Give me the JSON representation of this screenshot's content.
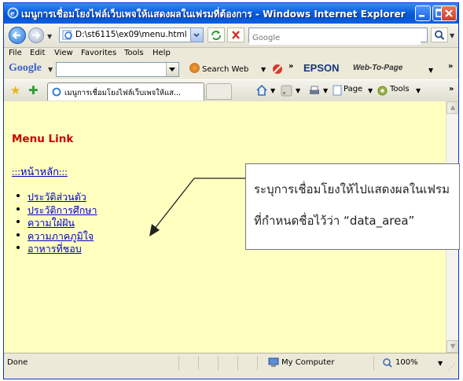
{
  "window": {
    "title": "เมนูการเชื่อมโยงไฟล์เว็บเพจให้แสดงผลในเฟรมที่ต้องการ - Windows Internet Explorer"
  },
  "address_bar": {
    "url": "D:\\st6115\\ex09\\menu.html",
    "search_placeholder": "Google"
  },
  "menu_bar": {
    "items": [
      "File",
      "Edit",
      "View",
      "Favorites",
      "Tools",
      "Help"
    ]
  },
  "google_toolbar": {
    "logo": "Google",
    "search_web_label": "Search Web",
    "epson_label": "EPSON",
    "web_to_page_label": "Web-To-Page"
  },
  "tab_bar": {
    "active_tab_title": "เมนูการเชื่อมโยงไฟล์เว็บเพจให้แส...",
    "page_label": "Page",
    "tools_label": "Tools"
  },
  "content": {
    "heading": "Menu Link",
    "home_link": ":::หน้าหลัก:::",
    "links": [
      "ประวัติส่วนตัว",
      "ประวัติการศึกษา",
      "ความใฝ่ฝัน",
      "ความภาคภูมิใจ",
      "อาหารที่ชอบ"
    ]
  },
  "callout": {
    "line1": "ระบุการเชื่อมโยงให้ไปแสดงผลในเฟรม",
    "line2": "ที่กำหนดชื่อไว้ว่า “data_area”"
  },
  "status_bar": {
    "status": "Done",
    "zone": "My Computer",
    "zoom": "100%"
  },
  "colors": {
    "content_background": "#ffffc0",
    "heading": "#cc0000",
    "link": "#0000cc",
    "titlebar": "#0a5fe0"
  }
}
